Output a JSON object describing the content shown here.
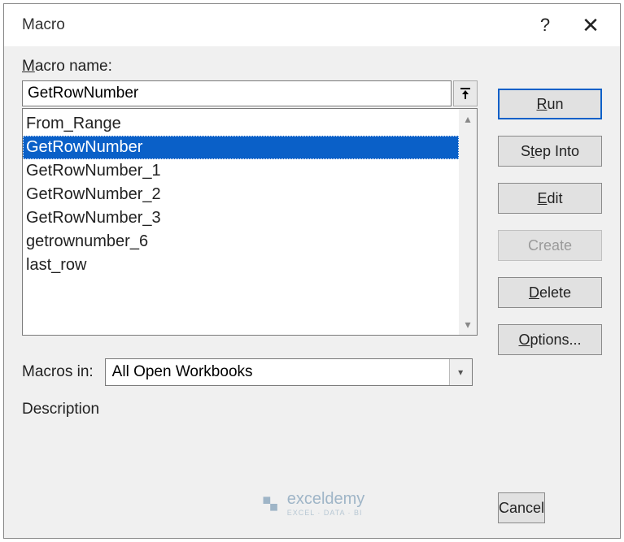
{
  "titlebar": {
    "title": "Macro",
    "help": "?",
    "close": "✕"
  },
  "labels": {
    "macro_name_prefix": "M",
    "macro_name_rest": "acro name:",
    "macros_in_prefix": "Macr",
    "macros_in_ul": "o",
    "macros_in_rest": "s in:",
    "description": "Description"
  },
  "macro_name_value": "GetRowNumber",
  "macros_in_value": "All Open Workbooks",
  "list": [
    {
      "name": "From_Range",
      "selected": false
    },
    {
      "name": "GetRowNumber",
      "selected": true
    },
    {
      "name": "GetRowNumber_1",
      "selected": false
    },
    {
      "name": "GetRowNumber_2",
      "selected": false
    },
    {
      "name": "GetRowNumber_3",
      "selected": false
    },
    {
      "name": "getrownumber_6",
      "selected": false
    },
    {
      "name": "last_row",
      "selected": false
    }
  ],
  "buttons": {
    "run_ul": "R",
    "run_rest": "un",
    "step_pre": "S",
    "step_ul": "t",
    "step_rest": "ep Into",
    "edit_ul": "E",
    "edit_rest": "dit",
    "create": "Create",
    "delete_ul": "D",
    "delete_rest": "elete",
    "options_ul": "O",
    "options_rest": "ptions...",
    "cancel": "Cancel"
  },
  "watermark": {
    "brand": "exceldemy",
    "tagline": "EXCEL · DATA · BI"
  }
}
